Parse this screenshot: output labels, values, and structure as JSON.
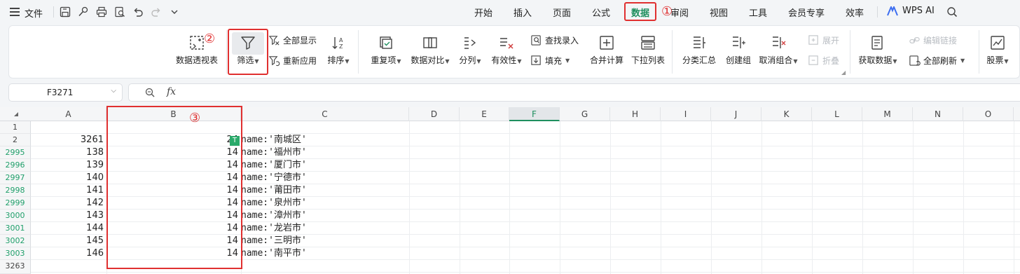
{
  "topbar": {
    "file_label": "文件",
    "tabs": [
      "开始",
      "插入",
      "页面",
      "公式",
      "数据",
      "审阅",
      "视图",
      "工具",
      "会员专享",
      "效率"
    ],
    "active_tab": "数据",
    "wps_ai_label": "WPS AI",
    "annotation_1": "①"
  },
  "ribbon": {
    "pivot_label": "数据透视表",
    "filter_label": "筛选",
    "show_all_label": "全部显示",
    "reapply_label": "重新应用",
    "sort_label": "排序",
    "duplicates_label": "重复项",
    "compare_label": "数据对比",
    "split_label": "分列",
    "validity_label": "有效性",
    "find_entry_label": "查找录入",
    "fill_label": "填充",
    "consolidate_label": "合并计算",
    "dropdown_list_label": "下拉列表",
    "subtotal_label": "分类汇总",
    "create_group_label": "创建组",
    "ungroup_label": "取消组合",
    "expand_label": "展开",
    "collapse_label": "折叠",
    "get_data_label": "获取数据",
    "edit_links_label": "编辑链接",
    "refresh_all_label": "全部刷新",
    "stocks_label": "股票",
    "annotation_2": "②"
  },
  "formula_bar": {
    "name_box": "F3271",
    "fx_label": "fx",
    "formula": ""
  },
  "grid": {
    "columns": [
      "A",
      "B",
      "C",
      "D",
      "E",
      "F",
      "G",
      "H",
      "I",
      "J",
      "K",
      "L",
      "M",
      "N",
      "O"
    ],
    "selected_column": "F",
    "annotation_3": "③",
    "rows": [
      {
        "num": "1",
        "a": "",
        "b": "",
        "c": "",
        "filtered": false
      },
      {
        "num": "2",
        "a": "3261",
        "b": "24",
        "c": "name:'南城区'",
        "filtered": false
      },
      {
        "num": "2995",
        "a": "138",
        "b": "14",
        "c": "name:'福州市'",
        "filtered": true
      },
      {
        "num": "2996",
        "a": "139",
        "b": "14",
        "c": "name:'厦门市'",
        "filtered": true
      },
      {
        "num": "2997",
        "a": "140",
        "b": "14",
        "c": "name:'宁德市'",
        "filtered": true
      },
      {
        "num": "2998",
        "a": "141",
        "b": "14",
        "c": "name:'莆田市'",
        "filtered": true
      },
      {
        "num": "2999",
        "a": "142",
        "b": "14",
        "c": "name:'泉州市'",
        "filtered": true
      },
      {
        "num": "3000",
        "a": "143",
        "b": "14",
        "c": "name:'漳州市'",
        "filtered": true
      },
      {
        "num": "3001",
        "a": "144",
        "b": "14",
        "c": "name:'龙岩市'",
        "filtered": true
      },
      {
        "num": "3002",
        "a": "145",
        "b": "14",
        "c": "name:'三明市'",
        "filtered": true
      },
      {
        "num": "3003",
        "a": "146",
        "b": "14",
        "c": "name:'南平市'",
        "filtered": true
      },
      {
        "num": "3263",
        "a": "",
        "b": "",
        "c": "",
        "filtered": false
      }
    ]
  },
  "colors": {
    "accent": "#1f8f5f",
    "annotation": "#e03030",
    "filtered_row_number": "#1f9f6a"
  }
}
